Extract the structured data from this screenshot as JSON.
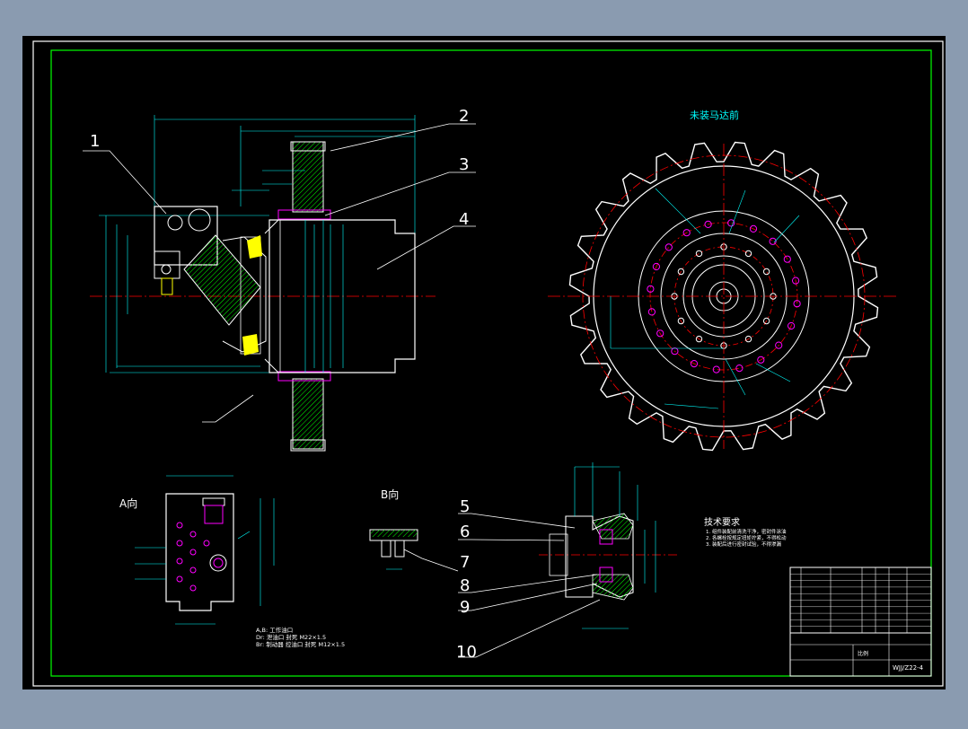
{
  "colors": {
    "background": "#8a9bb0",
    "sheet": "#000000",
    "frame": "#ffffff",
    "border": "#00ff00",
    "dim": "#00ffff",
    "outline": "#ffffff",
    "center": "#ff0000",
    "part": "#ff00ff",
    "hatch": "#00ff00",
    "leader": "#ffffff",
    "text": "#ffffff",
    "yellow": "#ffff00"
  },
  "callouts": [
    "1",
    "2",
    "3",
    "4",
    "5",
    "6",
    "7",
    "8",
    "9",
    "10"
  ],
  "views": {
    "sprocket_title": "未装马达前",
    "view_a": "A向",
    "view_b": "B向"
  },
  "notes": {
    "title": "技术要求",
    "lines": [
      "1. 组件装配前清洗干净，密封件涂油",
      "2. 各螺栓按规定扭矩拧紧，不得松动",
      "3. 装配后进行密封试验，不得渗漏"
    ]
  },
  "ports": {
    "lines": [
      "A,B:   工作油口",
      "Dr:   泄油口 封死  M22×1.5",
      "Br:   制动器 控油口 封死  M12×1.5"
    ]
  },
  "titleblock": {
    "drawing_no": "WJJ/Z22-4",
    "scale_label": "比例",
    "rows": 10
  }
}
